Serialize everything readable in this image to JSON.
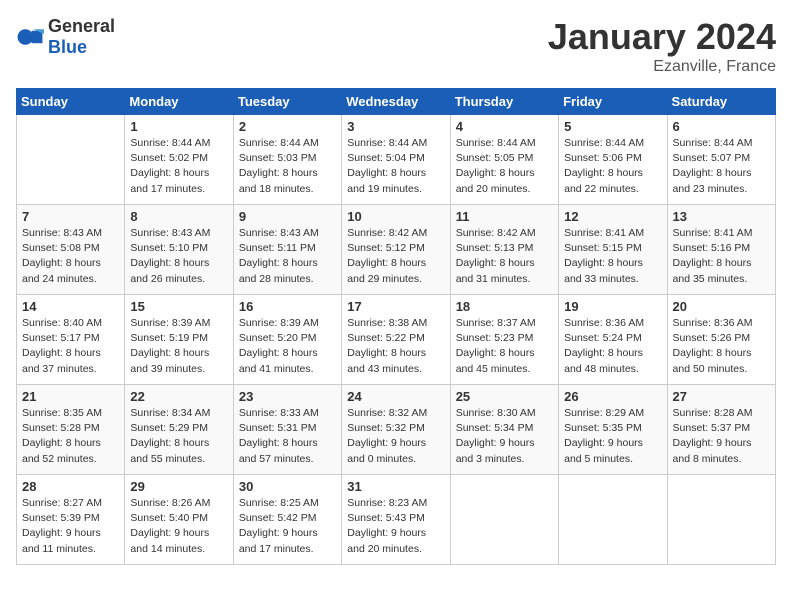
{
  "header": {
    "logo_general": "General",
    "logo_blue": "Blue",
    "month_year": "January 2024",
    "location": "Ezanville, France"
  },
  "columns": [
    "Sunday",
    "Monday",
    "Tuesday",
    "Wednesday",
    "Thursday",
    "Friday",
    "Saturday"
  ],
  "weeks": [
    [
      {
        "day": "",
        "sunrise": "",
        "sunset": "",
        "daylight": ""
      },
      {
        "day": "1",
        "sunrise": "Sunrise: 8:44 AM",
        "sunset": "Sunset: 5:02 PM",
        "daylight": "Daylight: 8 hours and 17 minutes."
      },
      {
        "day": "2",
        "sunrise": "Sunrise: 8:44 AM",
        "sunset": "Sunset: 5:03 PM",
        "daylight": "Daylight: 8 hours and 18 minutes."
      },
      {
        "day": "3",
        "sunrise": "Sunrise: 8:44 AM",
        "sunset": "Sunset: 5:04 PM",
        "daylight": "Daylight: 8 hours and 19 minutes."
      },
      {
        "day": "4",
        "sunrise": "Sunrise: 8:44 AM",
        "sunset": "Sunset: 5:05 PM",
        "daylight": "Daylight: 8 hours and 20 minutes."
      },
      {
        "day": "5",
        "sunrise": "Sunrise: 8:44 AM",
        "sunset": "Sunset: 5:06 PM",
        "daylight": "Daylight: 8 hours and 22 minutes."
      },
      {
        "day": "6",
        "sunrise": "Sunrise: 8:44 AM",
        "sunset": "Sunset: 5:07 PM",
        "daylight": "Daylight: 8 hours and 23 minutes."
      }
    ],
    [
      {
        "day": "7",
        "sunrise": "Sunrise: 8:43 AM",
        "sunset": "Sunset: 5:08 PM",
        "daylight": "Daylight: 8 hours and 24 minutes."
      },
      {
        "day": "8",
        "sunrise": "Sunrise: 8:43 AM",
        "sunset": "Sunset: 5:10 PM",
        "daylight": "Daylight: 8 hours and 26 minutes."
      },
      {
        "day": "9",
        "sunrise": "Sunrise: 8:43 AM",
        "sunset": "Sunset: 5:11 PM",
        "daylight": "Daylight: 8 hours and 28 minutes."
      },
      {
        "day": "10",
        "sunrise": "Sunrise: 8:42 AM",
        "sunset": "Sunset: 5:12 PM",
        "daylight": "Daylight: 8 hours and 29 minutes."
      },
      {
        "day": "11",
        "sunrise": "Sunrise: 8:42 AM",
        "sunset": "Sunset: 5:13 PM",
        "daylight": "Daylight: 8 hours and 31 minutes."
      },
      {
        "day": "12",
        "sunrise": "Sunrise: 8:41 AM",
        "sunset": "Sunset: 5:15 PM",
        "daylight": "Daylight: 8 hours and 33 minutes."
      },
      {
        "day": "13",
        "sunrise": "Sunrise: 8:41 AM",
        "sunset": "Sunset: 5:16 PM",
        "daylight": "Daylight: 8 hours and 35 minutes."
      }
    ],
    [
      {
        "day": "14",
        "sunrise": "Sunrise: 8:40 AM",
        "sunset": "Sunset: 5:17 PM",
        "daylight": "Daylight: 8 hours and 37 minutes."
      },
      {
        "day": "15",
        "sunrise": "Sunrise: 8:39 AM",
        "sunset": "Sunset: 5:19 PM",
        "daylight": "Daylight: 8 hours and 39 minutes."
      },
      {
        "day": "16",
        "sunrise": "Sunrise: 8:39 AM",
        "sunset": "Sunset: 5:20 PM",
        "daylight": "Daylight: 8 hours and 41 minutes."
      },
      {
        "day": "17",
        "sunrise": "Sunrise: 8:38 AM",
        "sunset": "Sunset: 5:22 PM",
        "daylight": "Daylight: 8 hours and 43 minutes."
      },
      {
        "day": "18",
        "sunrise": "Sunrise: 8:37 AM",
        "sunset": "Sunset: 5:23 PM",
        "daylight": "Daylight: 8 hours and 45 minutes."
      },
      {
        "day": "19",
        "sunrise": "Sunrise: 8:36 AM",
        "sunset": "Sunset: 5:24 PM",
        "daylight": "Daylight: 8 hours and 48 minutes."
      },
      {
        "day": "20",
        "sunrise": "Sunrise: 8:36 AM",
        "sunset": "Sunset: 5:26 PM",
        "daylight": "Daylight: 8 hours and 50 minutes."
      }
    ],
    [
      {
        "day": "21",
        "sunrise": "Sunrise: 8:35 AM",
        "sunset": "Sunset: 5:28 PM",
        "daylight": "Daylight: 8 hours and 52 minutes."
      },
      {
        "day": "22",
        "sunrise": "Sunrise: 8:34 AM",
        "sunset": "Sunset: 5:29 PM",
        "daylight": "Daylight: 8 hours and 55 minutes."
      },
      {
        "day": "23",
        "sunrise": "Sunrise: 8:33 AM",
        "sunset": "Sunset: 5:31 PM",
        "daylight": "Daylight: 8 hours and 57 minutes."
      },
      {
        "day": "24",
        "sunrise": "Sunrise: 8:32 AM",
        "sunset": "Sunset: 5:32 PM",
        "daylight": "Daylight: 9 hours and 0 minutes."
      },
      {
        "day": "25",
        "sunrise": "Sunrise: 8:30 AM",
        "sunset": "Sunset: 5:34 PM",
        "daylight": "Daylight: 9 hours and 3 minutes."
      },
      {
        "day": "26",
        "sunrise": "Sunrise: 8:29 AM",
        "sunset": "Sunset: 5:35 PM",
        "daylight": "Daylight: 9 hours and 5 minutes."
      },
      {
        "day": "27",
        "sunrise": "Sunrise: 8:28 AM",
        "sunset": "Sunset: 5:37 PM",
        "daylight": "Daylight: 9 hours and 8 minutes."
      }
    ],
    [
      {
        "day": "28",
        "sunrise": "Sunrise: 8:27 AM",
        "sunset": "Sunset: 5:39 PM",
        "daylight": "Daylight: 9 hours and 11 minutes."
      },
      {
        "day": "29",
        "sunrise": "Sunrise: 8:26 AM",
        "sunset": "Sunset: 5:40 PM",
        "daylight": "Daylight: 9 hours and 14 minutes."
      },
      {
        "day": "30",
        "sunrise": "Sunrise: 8:25 AM",
        "sunset": "Sunset: 5:42 PM",
        "daylight": "Daylight: 9 hours and 17 minutes."
      },
      {
        "day": "31",
        "sunrise": "Sunrise: 8:23 AM",
        "sunset": "Sunset: 5:43 PM",
        "daylight": "Daylight: 9 hours and 20 minutes."
      },
      {
        "day": "",
        "sunrise": "",
        "sunset": "",
        "daylight": ""
      },
      {
        "day": "",
        "sunrise": "",
        "sunset": "",
        "daylight": ""
      },
      {
        "day": "",
        "sunrise": "",
        "sunset": "",
        "daylight": ""
      }
    ]
  ]
}
